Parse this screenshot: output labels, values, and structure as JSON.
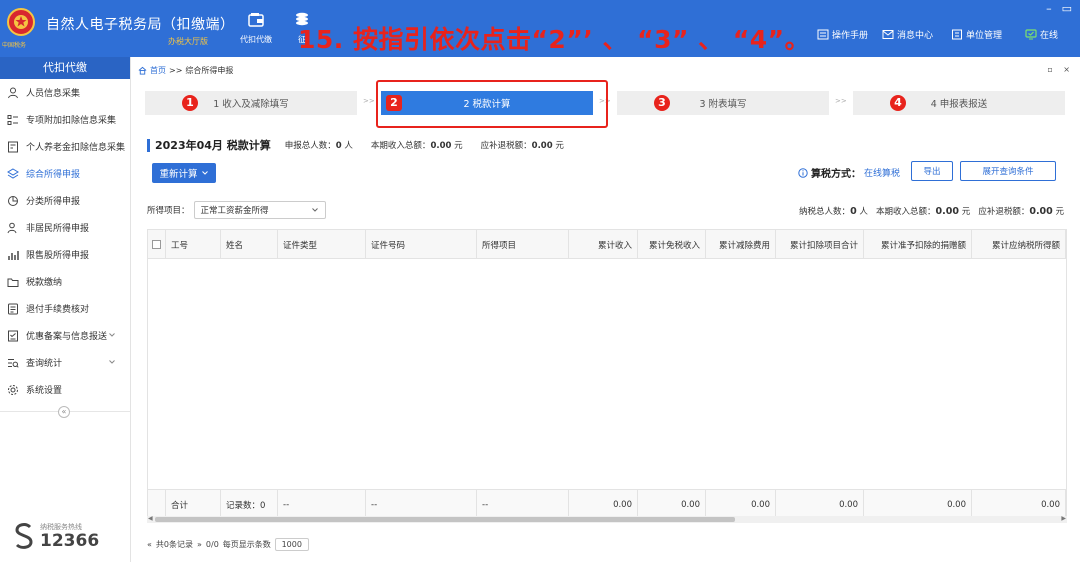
{
  "header": {
    "app_title": "自然人电子税务局（扣缴端）",
    "app_subtitle": "办税大厅版",
    "nav": [
      {
        "label": "代扣代缴",
        "icon": "wallet-icon"
      },
      {
        "label": "征",
        "icon": "coins-icon"
      }
    ],
    "overlay_instruction": "15. 按指引依次点击“2”’ 、 “3” 、 “4”。",
    "tools": [
      {
        "label": "操作手册",
        "icon": "manual-icon"
      },
      {
        "label": "消息中心",
        "icon": "message-icon"
      },
      {
        "label": "单位管理",
        "icon": "building-icon"
      },
      {
        "label": "在线",
        "icon": "online-icon"
      }
    ],
    "logo_text": "中国税务",
    "colors": {
      "header_bg": "#2f6fd6",
      "accent": "#2f6fd6",
      "alert_red": "#e8231c",
      "subtitle_gold": "#f5c542"
    }
  },
  "sidebar": {
    "header": "代扣代缴",
    "items": [
      {
        "label": "人员信息采集",
        "icon": "person-icon"
      },
      {
        "label": "专项附加扣除信息采集",
        "icon": "list-icon"
      },
      {
        "label": "个人养老金扣除信息采集",
        "icon": "pension-icon"
      },
      {
        "label": "综合所得申报",
        "icon": "layers-icon",
        "active": true
      },
      {
        "label": "分类所得申报",
        "icon": "pie-icon"
      },
      {
        "label": "非居民所得申报",
        "icon": "user-outline-icon"
      },
      {
        "label": "限售股所得申报",
        "icon": "bar-chart-icon"
      },
      {
        "label": "税款缴纳",
        "icon": "folder-icon"
      },
      {
        "label": "退付手续费核对",
        "icon": "document-icon"
      },
      {
        "label": "优惠备案与信息报送",
        "icon": "checklist-icon",
        "expandable": true
      },
      {
        "label": "查询统计",
        "icon": "search-list-icon",
        "expandable": true
      },
      {
        "label": "系统设置",
        "icon": "gear-icon"
      }
    ],
    "collapse_glyph": "«",
    "hotline_label": "纳税服务热线",
    "hotline_number": "12366"
  },
  "breadcrumb": {
    "home": "首页",
    "separator": ">>",
    "current": "综合所得申报"
  },
  "tab_controls": "▫ ×",
  "steps": [
    {
      "num": "1",
      "label": "1 收入及减除填写",
      "active": false
    },
    {
      "num": "2",
      "label": "2 税款计算",
      "active": true
    },
    {
      "num": "3",
      "label": "3 附表填写",
      "active": false
    },
    {
      "num": "4",
      "label": "4 申报表报送",
      "active": false
    }
  ],
  "step_arrow": ">>",
  "info": {
    "title": "2023年04月  税款计算",
    "declare_count_label": "申报总人数：",
    "declare_count_value": "0",
    "declare_count_unit": "人",
    "income_label": "本期收入总额：",
    "income_value": "0.00",
    "income_unit": "元",
    "refund_label": "应补退税额：",
    "refund_value": "0.00",
    "refund_unit": "元"
  },
  "toolbar": {
    "recalc_label": "重新计算",
    "calc_mode_label": "算税方式：",
    "calc_mode_value": "在线算税",
    "export_label": "导出",
    "expand_query_label": "展开查询条件"
  },
  "filter": {
    "label": "所得项目：",
    "selected": "正常工资薪金所得"
  },
  "totals": {
    "taxpayer_label": "纳税总人数：",
    "taxpayer_value": "0",
    "taxpayer_unit": "人",
    "income_label": "本期收入总额：",
    "income_value": "0.00",
    "income_unit": "元",
    "refund_label": "应补退税额：",
    "refund_value": "0.00",
    "refund_unit": "元"
  },
  "table": {
    "columns": [
      "工号",
      "姓名",
      "证件类型",
      "证件号码",
      "所得项目",
      "累计收入",
      "累计免税收入",
      "累计减除费用",
      "累计扣除项目合计",
      "累计准予扣除的捐赠额",
      "累计应纳税所得额"
    ],
    "footer": [
      "合计",
      "记录数：0",
      "--",
      "--",
      "--",
      "0.00",
      "0.00",
      "0.00",
      "0.00",
      "0.00",
      "0.00"
    ]
  },
  "pager": {
    "total_records": "共0条记录",
    "page": "0/0",
    "per_page_label": "每页显示条数",
    "per_page_value": "1000"
  }
}
